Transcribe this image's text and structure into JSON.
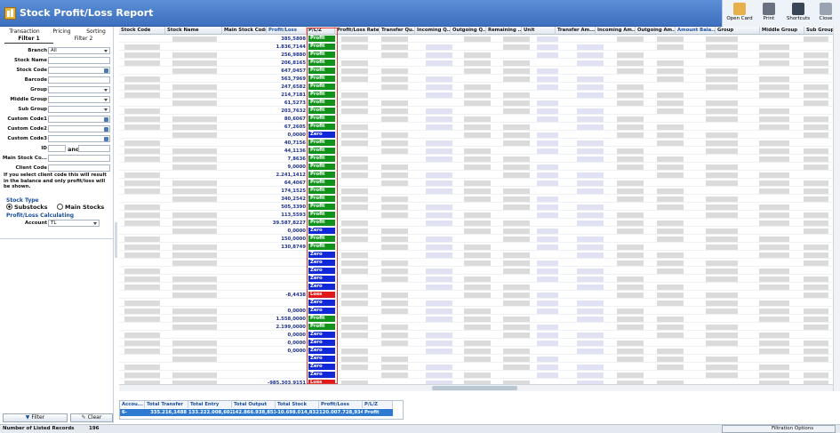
{
  "window": {
    "title": "Stock Profit/Loss Report"
  },
  "toolbar": {
    "open_card": "Open Card",
    "print": "Print",
    "shortcuts": "Shortcuts",
    "close": "Close"
  },
  "left": {
    "tabs": [
      "Transaction",
      "Pricing",
      "Sorting"
    ],
    "subtabs": [
      "Filter 1",
      "Filter 2"
    ],
    "branch_label": "Branch",
    "branch_value": "All",
    "stock_name_label": "Stock Name",
    "stock_code_label": "Stock Code",
    "barcode_label": "Barcode",
    "group_label": "Group",
    "middle_group_label": "Middle Group",
    "sub_group_label": "Sub Group",
    "custom1_label": "Custom Code1",
    "custom2_label": "Custom Code2",
    "custom3_label": "Custom Code3",
    "id_label": "ID",
    "and_label": "and",
    "main_stock_label": "Main Stock Co...",
    "client_code_label": "Client Code",
    "note": "If you select client code this will result in the balance and only profit/loss will be shown.",
    "stock_type_label": "Stock Type",
    "substocks_label": "Substocks",
    "main_stocks_label": "Main Stocks",
    "pl_calc_label": "Profit/Loss Calculating",
    "account_label": "Account",
    "account_value": "TL",
    "filter_btn": "Filter",
    "clear_btn": "Clear"
  },
  "grid": {
    "columns": [
      "Stock Code",
      "Stock Name",
      "Main Stock Code",
      "Profit/Loss",
      "P/L/Z",
      "Profit/Loss Rate",
      "Transfer Qu...",
      "Incoming Q...",
      "Outgoing Q...",
      "Remaining ...",
      "Unit",
      "Transfer Am...",
      "Incoming Am...",
      "Outgoing Am...",
      "Amount Bala...",
      "Group",
      "Middle Group",
      "Sub Group"
    ],
    "rows": [
      {
        "pl": "385,5808",
        "pz": "Profit"
      },
      {
        "pl": "1.836,7144",
        "pz": "Profit"
      },
      {
        "pl": "256,9880",
        "pz": "Profit"
      },
      {
        "pl": "206,8165",
        "pz": "Profit"
      },
      {
        "pl": "647,0457",
        "pz": "Profit"
      },
      {
        "pl": "563,7969",
        "pz": "Profit"
      },
      {
        "pl": "247,6582",
        "pz": "Profit"
      },
      {
        "pl": "214,7181",
        "pz": "Profit"
      },
      {
        "pl": "61,5273",
        "pz": "Profit"
      },
      {
        "pl": "203,7632",
        "pz": "Profit"
      },
      {
        "pl": "80,6067",
        "pz": "Profit"
      },
      {
        "pl": "67,2605",
        "pz": "Profit"
      },
      {
        "pl": "0,0000",
        "pz": "Zero"
      },
      {
        "pl": "40,7156",
        "pz": "Profit"
      },
      {
        "pl": "44,1136",
        "pz": "Profit"
      },
      {
        "pl": "7,8636",
        "pz": "Profit"
      },
      {
        "pl": "9,0000",
        "pz": "Profit"
      },
      {
        "pl": "2.241,1412",
        "pz": "Profit"
      },
      {
        "pl": "64,4067",
        "pz": "Profit"
      },
      {
        "pl": "174,1525",
        "pz": "Profit"
      },
      {
        "pl": "340,2542",
        "pz": "Profit"
      },
      {
        "pl": "505,3390",
        "pz": "Profit"
      },
      {
        "pl": "113,5593",
        "pz": "Profit"
      },
      {
        "pl": "39.587,8227",
        "pz": "Profit"
      },
      {
        "pl": "0,0000",
        "pz": "Zero"
      },
      {
        "pl": "150,0000",
        "pz": "Profit"
      },
      {
        "pl": "130,8749",
        "pz": "Profit"
      },
      {
        "pl": "",
        "pz": "Zero"
      },
      {
        "pl": "",
        "pz": "Zero"
      },
      {
        "pl": "",
        "pz": "Zero"
      },
      {
        "pl": "",
        "pz": "Zero"
      },
      {
        "pl": "",
        "pz": "Zero"
      },
      {
        "pl": "-8,4438",
        "pz": "Loss"
      },
      {
        "pl": "",
        "pz": "Zero"
      },
      {
        "pl": "0,0000",
        "pz": "Zero"
      },
      {
        "pl": "1.558,0000",
        "pz": "Profit"
      },
      {
        "pl": "2.199,0000",
        "pz": "Profit"
      },
      {
        "pl": "0,0000",
        "pz": "Zero"
      },
      {
        "pl": "0,0000",
        "pz": "Zero"
      },
      {
        "pl": "0,0000",
        "pz": "Zero"
      },
      {
        "pl": "",
        "pz": "Zero"
      },
      {
        "pl": "",
        "pz": "Zero"
      },
      {
        "pl": "",
        "pz": "Zero"
      },
      {
        "pl": "-985.303,9151",
        "pz": "Loss"
      }
    ]
  },
  "summary": {
    "headers": [
      "Accou...",
      "Total Transfer",
      "Total Entry",
      "Total Output",
      "Total Stock",
      "Profit/Loss",
      "P/L/Z"
    ],
    "values": [
      "6-",
      "335.216,1488",
      "133.222.008,6027",
      "142.866.938,8534",
      "-10.698.014,8327",
      "120.007.728,9346",
      "Profit"
    ]
  },
  "status": {
    "records_label": "Number of Listed Records",
    "records_value": "196",
    "filtration": "Filtration Options"
  }
}
